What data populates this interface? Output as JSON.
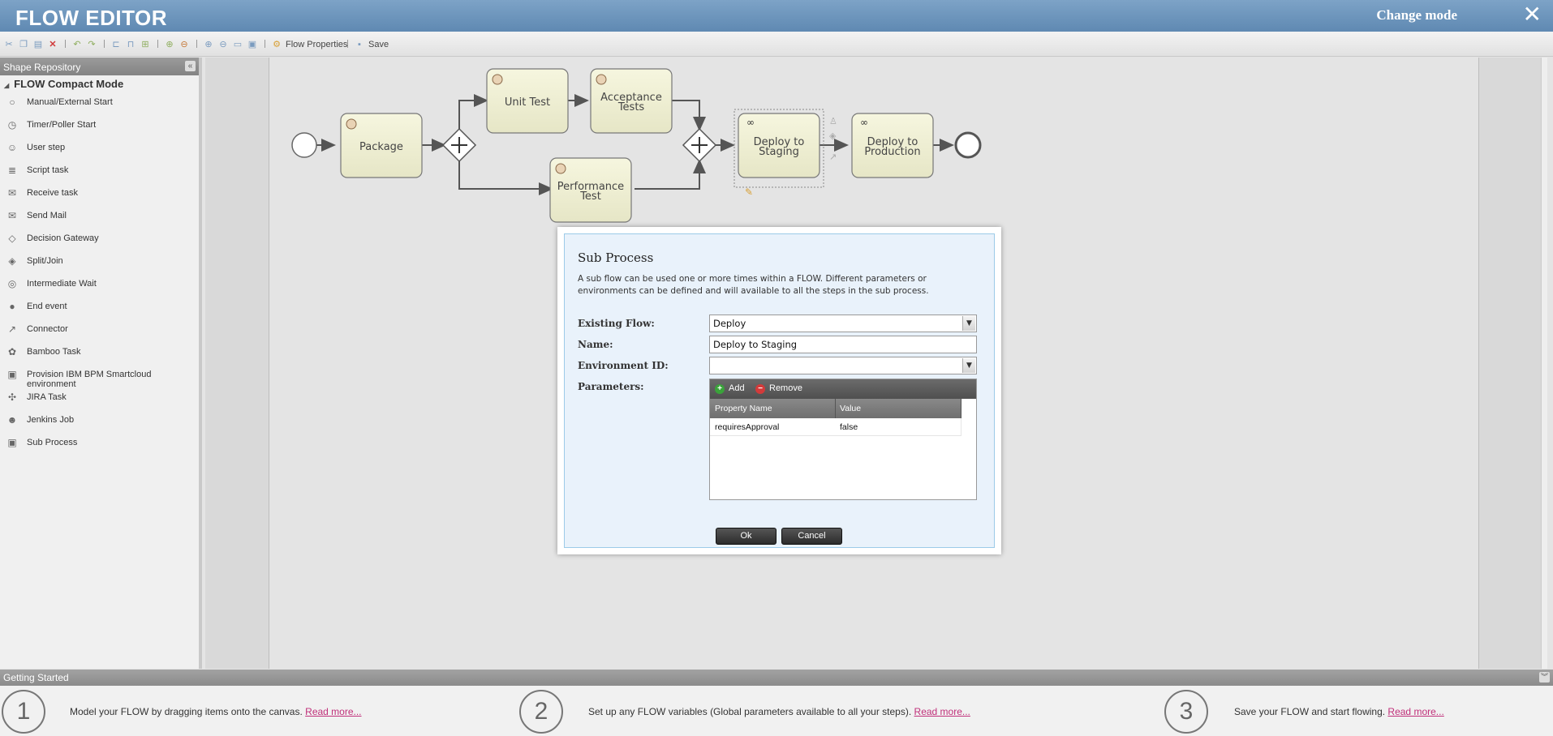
{
  "header": {
    "title": "FLOW EDITOR",
    "change_mode": "Change mode",
    "close_icon": "close-icon"
  },
  "toolbar": {
    "flow_properties": "Flow Properties",
    "save": "Save"
  },
  "sidebar": {
    "heading": "Shape Repository",
    "group": "FLOW Compact Mode",
    "items": [
      {
        "label": "Manual/External Start",
        "icon": "circle-icon"
      },
      {
        "label": "Timer/Poller Start",
        "icon": "clock-icon"
      },
      {
        "label": "User step",
        "icon": "user-icon"
      },
      {
        "label": "Script task",
        "icon": "script-icon"
      },
      {
        "label": "Receive task",
        "icon": "envelope-icon"
      },
      {
        "label": "Send Mail",
        "icon": "envelope-filled-icon"
      },
      {
        "label": "Decision Gateway",
        "icon": "diamond-x-icon"
      },
      {
        "label": "Split/Join",
        "icon": "diamond-plus-icon"
      },
      {
        "label": "Intermediate Wait",
        "icon": "double-circle-icon"
      },
      {
        "label": "End event",
        "icon": "thick-circle-icon"
      },
      {
        "label": "Connector",
        "icon": "arrow-icon"
      },
      {
        "label": "Bamboo Task",
        "icon": "bamboo-icon"
      },
      {
        "label": "Provision IBM BPM Smartcloud environment",
        "icon": "box-icon"
      },
      {
        "label": "JIRA Task",
        "icon": "jira-icon"
      },
      {
        "label": "Jenkins Job",
        "icon": "jenkins-icon"
      },
      {
        "label": "Sub Process",
        "icon": "subprocess-icon"
      }
    ]
  },
  "diagram": {
    "nodes": {
      "package": "Package",
      "unit_test": "Unit Test",
      "acceptance_1": "Acceptance",
      "acceptance_2": "Tests",
      "perf_1": "Performance",
      "perf_2": "Test",
      "staging_1": "Deploy to",
      "staging_2": "Staging",
      "prod_1": "Deploy to",
      "prod_2": "Production"
    }
  },
  "dialog": {
    "title": "Sub Process",
    "description": "A sub flow can be used one or more times within a FLOW. Different parameters or environments can be defined and will available to all the steps in the sub process.",
    "existing_flow_label": "Existing Flow:",
    "existing_flow_value": "Deploy",
    "name_label": "Name:",
    "name_value": "Deploy to Staging",
    "env_label": "Environment ID:",
    "env_value": "",
    "params_label": "Parameters:",
    "add": "Add",
    "remove": "Remove",
    "columns": [
      "Property Name",
      "Value"
    ],
    "rows": [
      {
        "name": "requiresApproval",
        "value": "false"
      }
    ],
    "ok": "Ok",
    "cancel": "Cancel"
  },
  "getting_started": {
    "heading": "Getting Started",
    "steps": [
      {
        "num": "1",
        "text": "Model your FLOW by dragging items onto the canvas.",
        "link": "Read more..."
      },
      {
        "num": "2",
        "text": "Set up any FLOW variables (Global parameters available to all your steps).",
        "link": "Read more..."
      },
      {
        "num": "3",
        "text": "Save your FLOW and start flowing.",
        "link": "Read more..."
      }
    ]
  }
}
